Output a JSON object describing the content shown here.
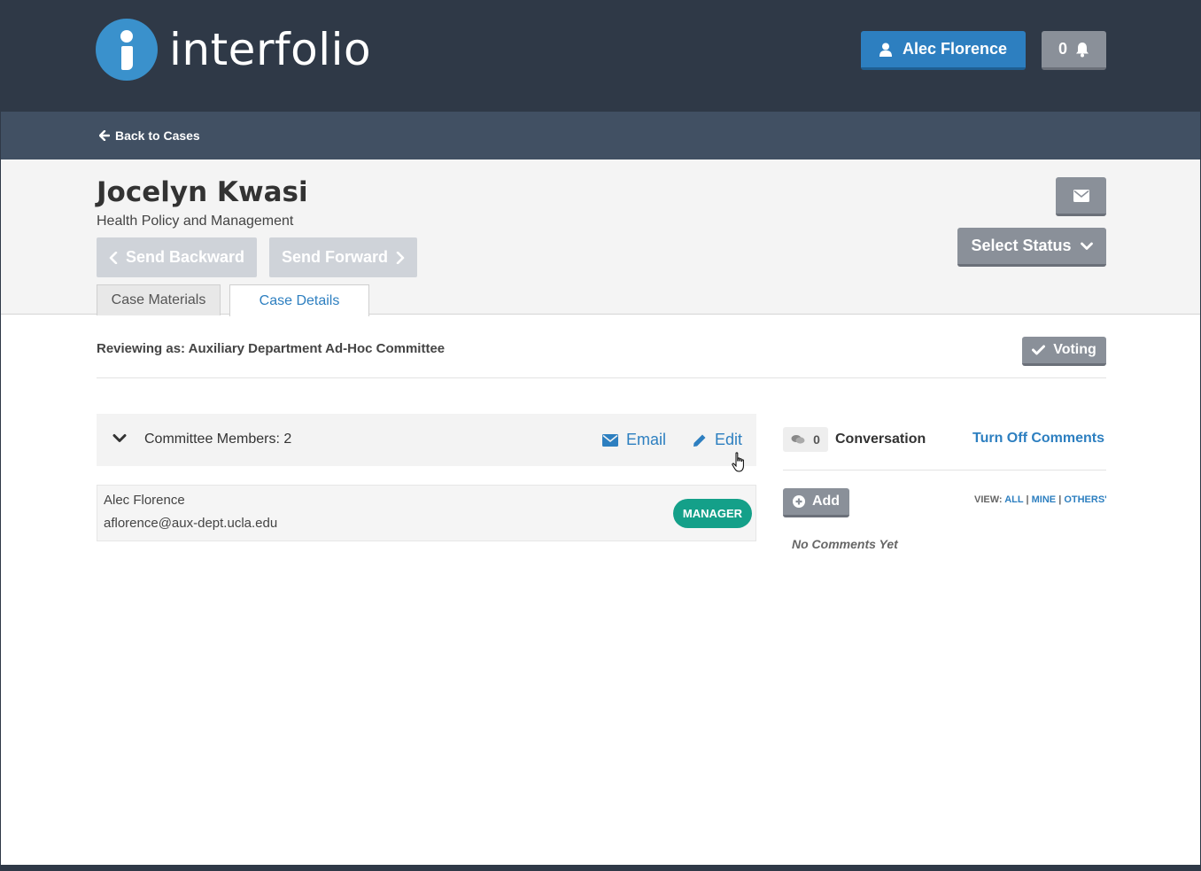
{
  "header": {
    "logo_text": "interfolio",
    "user_name": "Alec Florence",
    "notification_count": "0"
  },
  "backbar": {
    "back_label": "Back to Cases"
  },
  "case": {
    "name": "Jocelyn Kwasi",
    "department": "Health Policy and Management",
    "send_backward": "Send Backward",
    "send_forward": "Send Forward",
    "select_status": "Select Status",
    "tabs": [
      {
        "label": "Case Materials",
        "active": false
      },
      {
        "label": "Case Details",
        "active": true
      }
    ]
  },
  "details": {
    "reviewing_as": "Reviewing as: Auxiliary Department Ad-Hoc Committee",
    "voting_label": "Voting"
  },
  "committee": {
    "title": "Committee Members: 2",
    "email_label": "Email",
    "edit_label": "Edit",
    "members": [
      {
        "name": "Alec Florence",
        "email": "aflorence@aux-dept.ucla.edu",
        "role": "MANAGER"
      }
    ]
  },
  "conversation": {
    "count": "0",
    "title": "Conversation",
    "turn_off_label": "Turn Off Comments",
    "add_label": "Add",
    "view_label": "VIEW:",
    "view_all": "ALL",
    "view_mine": "MINE",
    "view_others": "OTHERS'",
    "separator": "|",
    "empty_text": "No Comments Yet"
  },
  "colors": {
    "header_bg": "#2f3947",
    "backbar_bg": "#415063",
    "accent_blue": "#2d7fc0",
    "gray_button": "#8a9099",
    "manager_badge": "#14a089"
  },
  "icons": {
    "user": "user-icon",
    "bell": "bell-icon",
    "back_arrow": "arrow-left-icon",
    "envelope": "envelope-icon",
    "chevron_down": "chevron-down-icon",
    "check": "check-icon",
    "pencil": "pencil-icon",
    "comments": "comments-icon",
    "plus_circle": "plus-circle-icon",
    "hand_cursor": "hand-cursor-icon"
  }
}
